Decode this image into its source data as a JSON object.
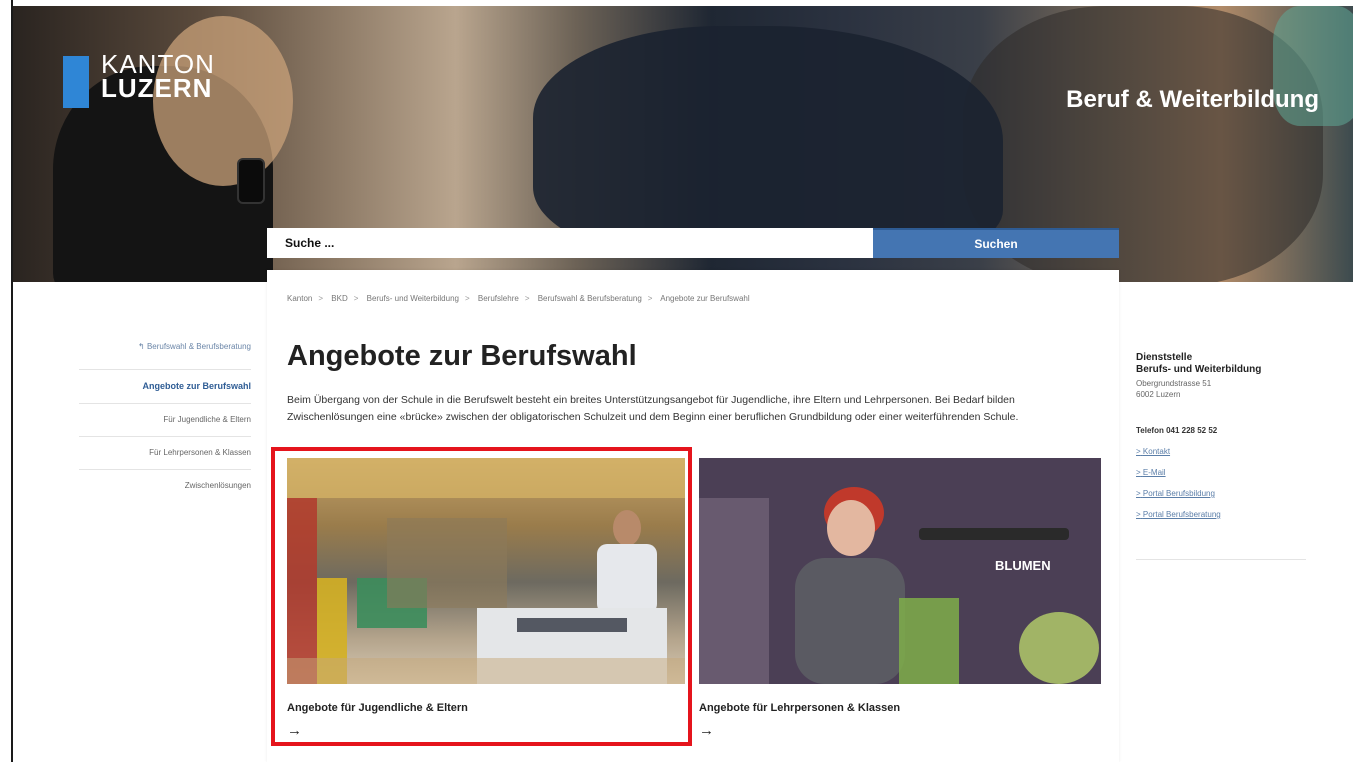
{
  "header": {
    "logo_line1": "KANTON",
    "logo_line2": "LUZERN",
    "department": "Beruf & Weiterbildung"
  },
  "search": {
    "placeholder": "Suche ...",
    "button_label": "Suchen"
  },
  "breadcrumb": [
    "Kanton",
    "BKD",
    "Berufs- und Weiterbildung",
    "Berufslehre",
    "Berufswahl & Berufsberatung",
    "Angebote zur Berufswahl"
  ],
  "breadcrumb_sep": ">",
  "left_nav": {
    "back": "Berufswahl & Berufsberatung",
    "items": [
      {
        "label": "Angebote zur Berufswahl",
        "active": true
      },
      {
        "label": "Für Jugendliche & Eltern",
        "active": false
      },
      {
        "label": "Für Lehrpersonen & Klassen",
        "active": false
      },
      {
        "label": "Zwischenlösungen",
        "active": false
      }
    ]
  },
  "main": {
    "title": "Angebote zur Berufswahl",
    "intro": "Beim Übergang von der Schule in die Berufswelt besteht ein breites Unterstützungsangebot für Jugendliche, ihre Eltern und Lehrpersonen. Bei Bedarf bilden Zwischenlösungen eine «brücke» zwischen der obligatorischen Schulzeit und dem Beginn einer beruflichen Grundbildung oder einer weiterführenden Schule.",
    "cards": [
      {
        "label": "Angebote für Jugendliche & Eltern",
        "arrow": "→"
      },
      {
        "label": "Angebote für Lehrpersonen & Klassen",
        "arrow": "→"
      }
    ],
    "card2_sign": "BLUMEN"
  },
  "right_info": {
    "title_line1": "Dienststelle",
    "title_line2": "Berufs- und Weiterbildung",
    "address_line1": "Obergrundstrasse 51",
    "address_line2": "6002 Luzern",
    "phone": "Telefon 041 228 52 52",
    "links": [
      "Kontakt",
      "E-Mail",
      "Portal Berufsbildung",
      "Portal Berufsberatung"
    ],
    "link_prefix": ">"
  }
}
